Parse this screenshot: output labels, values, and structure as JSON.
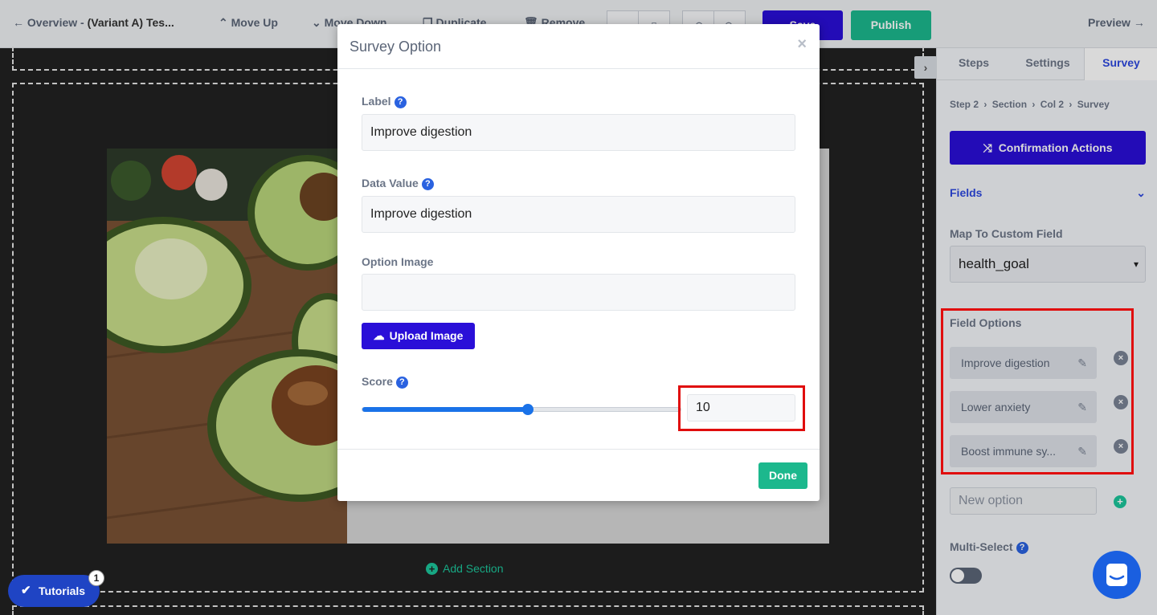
{
  "topbar": {
    "back_label": "Overview - ",
    "variant_label": "(Variant A) Tes...",
    "move_up_label": "Move Up",
    "move_down_label": "Move Down",
    "duplicate_label": "Duplicate",
    "remove_label": "Remove",
    "save_label": "Save",
    "publish_label": "Publish",
    "preview_label": "Preview"
  },
  "canvas": {
    "add_section_label": "Add Section"
  },
  "modal": {
    "title": "Survey Option",
    "close_glyph": "×",
    "label_field": {
      "label": "Label",
      "value": "Improve digestion"
    },
    "data_value_field": {
      "label": "Data Value",
      "value": "Improve digestion"
    },
    "option_image_label": "Option Image",
    "upload_label": "Upload Image",
    "score": {
      "label": "Score",
      "value": "10",
      "slider_fraction": 0.52
    },
    "done_label": "Done"
  },
  "right_panel": {
    "tabs": [
      {
        "label": "Steps"
      },
      {
        "label": "Settings"
      },
      {
        "label": "Survey"
      }
    ],
    "breadcrumb": [
      "Step 2",
      "Section",
      "Col 2",
      "Survey"
    ],
    "confirmation_label": "Confirmation Actions",
    "fields_label": "Fields",
    "map_label": "Map To Custom Field",
    "map_value": "health_goal",
    "field_options_label": "Field Options",
    "options": [
      {
        "label": "Improve digestion"
      },
      {
        "label": "Lower anxiety"
      },
      {
        "label": "Boost immune sy..."
      }
    ],
    "new_option_placeholder": "New option",
    "multiselect_label": "Multi-Select"
  },
  "tutorials": {
    "label": "Tutorials",
    "badge": "1"
  },
  "colors": {
    "primary": "#2a0fd8",
    "accent_green": "#1cb88d",
    "highlight_red": "#e00d0d",
    "slider_blue": "#1a72e8"
  }
}
